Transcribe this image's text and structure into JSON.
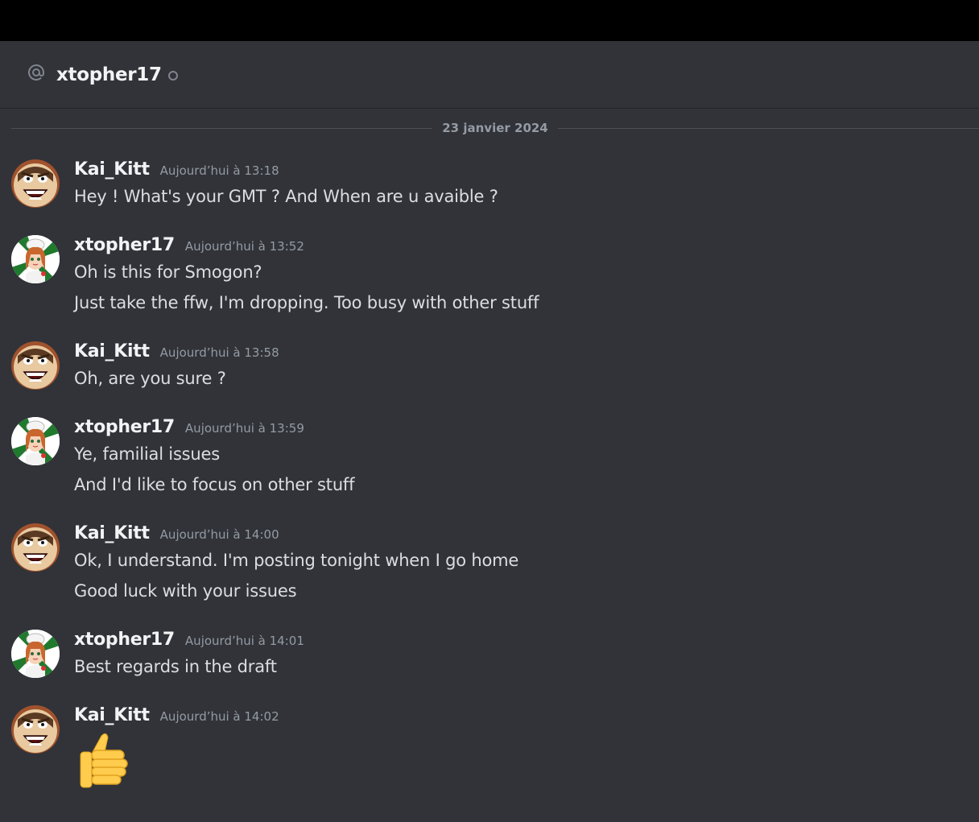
{
  "header": {
    "at_icon": "at-sign-icon",
    "channel_name": "xtopher17",
    "status_icon": "offline-status-icon"
  },
  "date_divider": "23 janvier 2024",
  "messages": [
    {
      "author": "Kai_Kitt",
      "avatar": "kai-avatar",
      "time": "Aujourd’hui à 13:18",
      "lines": [
        "Hey ! What's your GMT ? And When are u avaible ?"
      ]
    },
    {
      "author": "xtopher17",
      "avatar": "xtopher-avatar",
      "time": "Aujourd’hui à 13:52",
      "lines": [
        "Oh is this for Smogon?",
        "Just take the ffw, I'm dropping. Too busy with other stuff"
      ]
    },
    {
      "author": "Kai_Kitt",
      "avatar": "kai-avatar",
      "time": "Aujourd’hui à 13:58",
      "lines": [
        "Oh, are you sure ?"
      ]
    },
    {
      "author": "xtopher17",
      "avatar": "xtopher-avatar",
      "time": "Aujourd’hui à 13:59",
      "lines": [
        "Ye, familial issues",
        "And I'd like to focus on other stuff"
      ]
    },
    {
      "author": "Kai_Kitt",
      "avatar": "kai-avatar",
      "time": "Aujourd’hui à 14:00",
      "lines": [
        "Ok, I understand. I'm posting tonight when I go home",
        "Good luck with your issues"
      ]
    },
    {
      "author": "xtopher17",
      "avatar": "xtopher-avatar",
      "time": "Aujourd’hui à 14:01",
      "lines": [
        "Best regards in the draft"
      ]
    },
    {
      "author": "Kai_Kitt",
      "avatar": "kai-avatar",
      "time": "Aujourd’hui à 14:02",
      "emoji": "thumbs-up-emoji"
    }
  ]
}
